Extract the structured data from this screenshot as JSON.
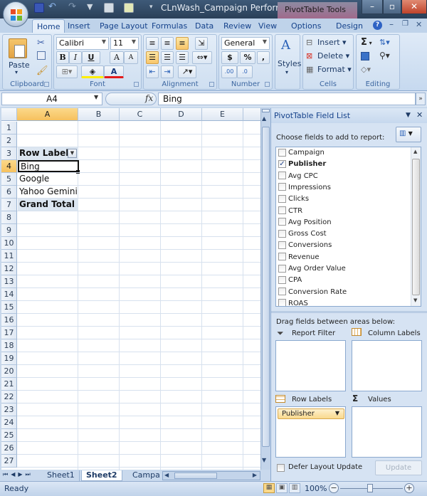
{
  "title_bar": {
    "document_title": "CLnWash_Campaign Performa...",
    "contextual_tab": "PivotTable Tools",
    "window_buttons": [
      "minimize-icon",
      "restore-icon",
      "close-icon"
    ]
  },
  "quick_access": [
    "save-icon",
    "undo-icon",
    "redo-icon",
    "filter-icon",
    "form-icon",
    "refresh-icon",
    "customize-icon"
  ],
  "ribbon_tabs": [
    {
      "label": "Home",
      "active": true
    },
    {
      "label": "Insert"
    },
    {
      "label": "Page Layout"
    },
    {
      "label": "Formulas"
    },
    {
      "label": "Data"
    },
    {
      "label": "Review"
    },
    {
      "label": "View"
    },
    {
      "label": "Options"
    },
    {
      "label": "Design"
    }
  ],
  "ribbon": {
    "clipboard": {
      "label": "Clipboard",
      "paste": "Paste"
    },
    "font": {
      "label": "Font",
      "font_name": "Calibri",
      "font_size": "11",
      "bold": "B",
      "italic": "I",
      "underline": "U",
      "grow": "A",
      "shrink": "A",
      "font_color_letter": "A"
    },
    "alignment": {
      "label": "Alignment"
    },
    "number": {
      "label": "Number",
      "format": "General",
      "currency": "$",
      "percent": "%",
      "comma": ","
    },
    "styles": {
      "label": "Styles"
    },
    "cells": {
      "label": "Cells",
      "insert": "Insert",
      "delete": "Delete",
      "format": "Format"
    },
    "editing": {
      "label": "Editing",
      "sum": "Σ"
    }
  },
  "formula_bar": {
    "name_box": "A4",
    "fx": "fx",
    "content": "Bing"
  },
  "sheet": {
    "columns": [
      "A",
      "B",
      "C",
      "D",
      "E"
    ],
    "selected_column": "A",
    "selected_row": 4,
    "rows": [
      "1",
      "2",
      "3",
      "4",
      "5",
      "6",
      "7",
      "8",
      "9",
      "10",
      "11",
      "12",
      "13",
      "14",
      "15",
      "16",
      "17",
      "18",
      "19",
      "20",
      "21",
      "22",
      "23",
      "24",
      "25",
      "26",
      "27"
    ],
    "cells": [
      {
        "row": 3,
        "value": "Row Labels",
        "style": "pivot-header"
      },
      {
        "row": 4,
        "value": "Bing",
        "style": "selected"
      },
      {
        "row": 5,
        "value": "Google"
      },
      {
        "row": 6,
        "value": "Yahoo Gemini"
      },
      {
        "row": 7,
        "value": "Grand Total",
        "style": "pivot-header"
      }
    ]
  },
  "sheet_tabs": [
    {
      "label": "Sheet1"
    },
    {
      "label": "Sheet2",
      "active": true
    },
    {
      "label": "Campa"
    }
  ],
  "status_bar": {
    "status": "Ready",
    "zoom": "100%"
  },
  "pivot_pane": {
    "title": "PivotTable Field List",
    "choose_label": "Choose fields to add to report:",
    "fields": [
      {
        "name": "Campaign",
        "checked": false
      },
      {
        "name": "Publisher",
        "checked": true
      },
      {
        "name": "Avg CPC",
        "checked": false
      },
      {
        "name": "Impressions",
        "checked": false
      },
      {
        "name": "Clicks",
        "checked": false
      },
      {
        "name": "CTR",
        "checked": false
      },
      {
        "name": "Avg Position",
        "checked": false
      },
      {
        "name": "Gross Cost",
        "checked": false
      },
      {
        "name": "Conversions",
        "checked": false
      },
      {
        "name": "Revenue",
        "checked": false
      },
      {
        "name": "Avg Order Value",
        "checked": false
      },
      {
        "name": "CPA",
        "checked": false
      },
      {
        "name": "Conversion Rate",
        "checked": false
      },
      {
        "name": "ROAS",
        "checked": false
      }
    ],
    "drag_label": "Drag fields between areas below:",
    "areas": {
      "report_filter": "Report Filter",
      "column_labels": "Column Labels",
      "row_labels": "Row Labels",
      "values": "Values"
    },
    "row_label_items": [
      "Publisher"
    ],
    "defer_label": "Defer Layout Update",
    "update_button": "Update"
  }
}
